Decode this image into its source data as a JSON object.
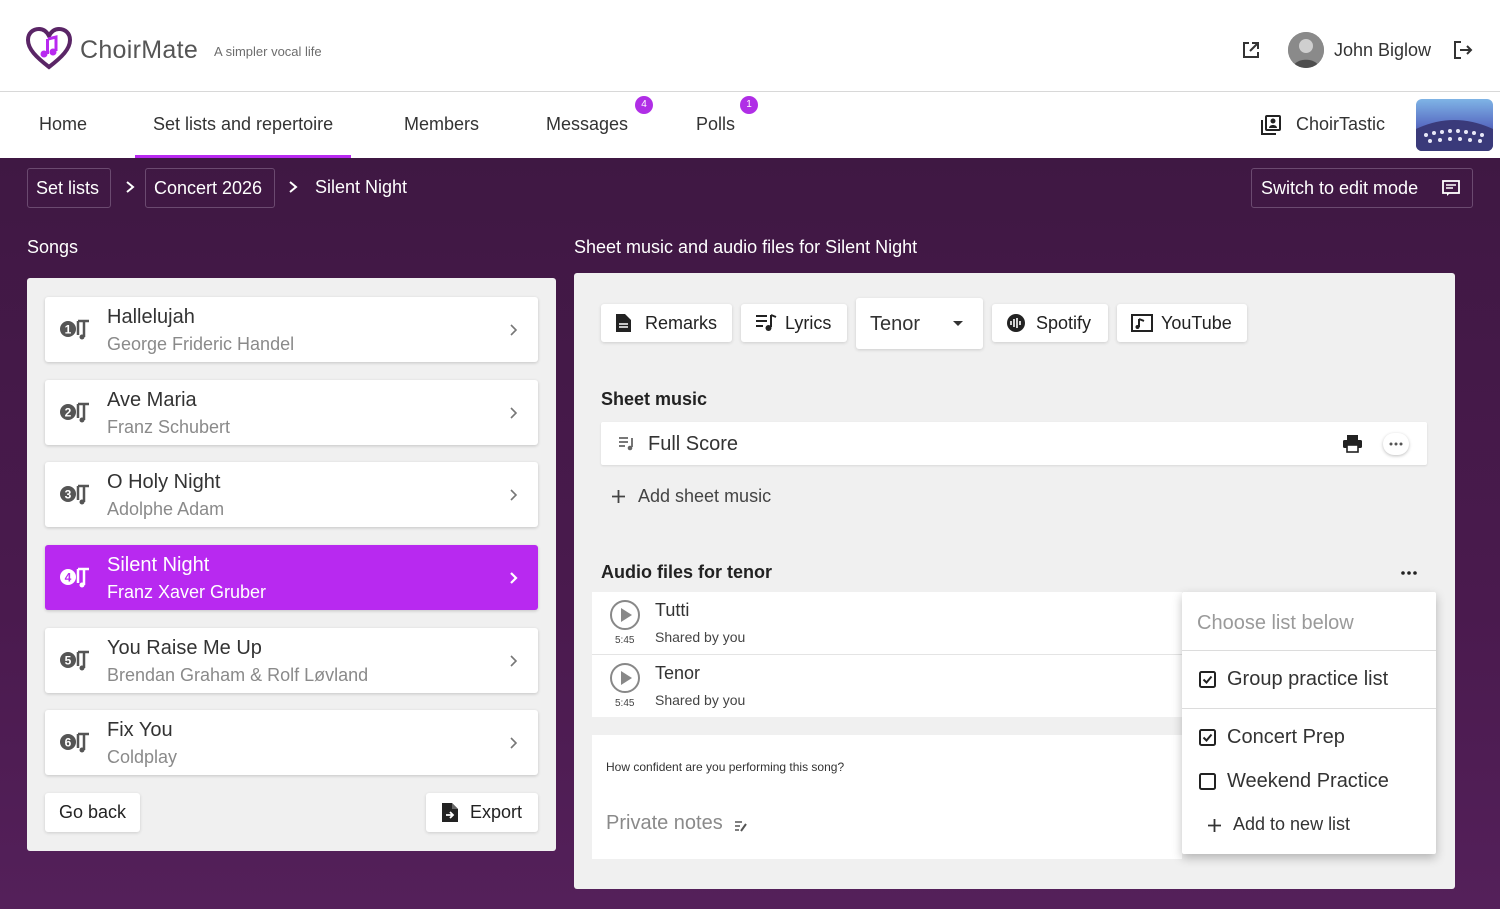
{
  "header": {
    "brand": "ChoirMate",
    "tagline": "A simpler vocal life",
    "user_name": "John Biglow",
    "icons": [
      "external-link-icon",
      "logout-icon"
    ]
  },
  "nav": {
    "items": [
      {
        "label": "Home"
      },
      {
        "label": "Set lists and repertoire",
        "active": true
      },
      {
        "label": "Members"
      },
      {
        "label": "Messages",
        "badge": "4"
      },
      {
        "label": "Polls",
        "badge": "1"
      }
    ],
    "choir_name": "ChoirTastic"
  },
  "breadcrumb": {
    "set_lists": "Set lists",
    "concert": "Concert 2026",
    "current": "Silent Night"
  },
  "edit_mode_label": "Switch to edit mode",
  "songs": {
    "title": "Songs",
    "items": [
      {
        "num": "1",
        "title": "Hallelujah",
        "artist": "George Frideric Handel"
      },
      {
        "num": "2",
        "title": "Ave Maria",
        "artist": "Franz Schubert"
      },
      {
        "num": "3",
        "title": "O Holy Night",
        "artist": "Adolphe Adam"
      },
      {
        "num": "4",
        "title": "Silent Night",
        "artist": "Franz Xaver Gruber",
        "active": true
      },
      {
        "num": "5",
        "title": "You Raise Me Up",
        "artist": "Brendan Graham & Rolf Løvland"
      },
      {
        "num": "6",
        "title": "Fix You",
        "artist": "Coldplay"
      }
    ],
    "go_back": "Go back",
    "export": "Export"
  },
  "music": {
    "title": "Sheet music and audio files for Silent Night",
    "remarks": "Remarks",
    "lyrics": "Lyrics",
    "voice": "Tenor",
    "spotify": "Spotify",
    "youtube": "YouTube",
    "sheet_music_title": "Sheet music",
    "score_name": "Full Score",
    "add_sheet_music": "Add sheet music",
    "audio_title": "Audio files for tenor",
    "audio_files": [
      {
        "title": "Tutti",
        "duration": "5:45",
        "shared": "Shared by you"
      },
      {
        "title": "Tenor",
        "duration": "5:45",
        "shared": "Shared by you"
      }
    ],
    "confidence_question": "How confident are you performing this song?",
    "private_notes": "Private notes"
  },
  "list_menu": {
    "header": "Choose list below",
    "items": [
      {
        "label": "Group practice list",
        "checked": true
      },
      {
        "label": "Concert Prep",
        "checked": true
      },
      {
        "label": "Weekend Practice",
        "checked": false
      }
    ],
    "add_new": "Add to new list"
  },
  "colors": {
    "accent": "#b829f0",
    "background_purple": "#4a1a4e"
  }
}
